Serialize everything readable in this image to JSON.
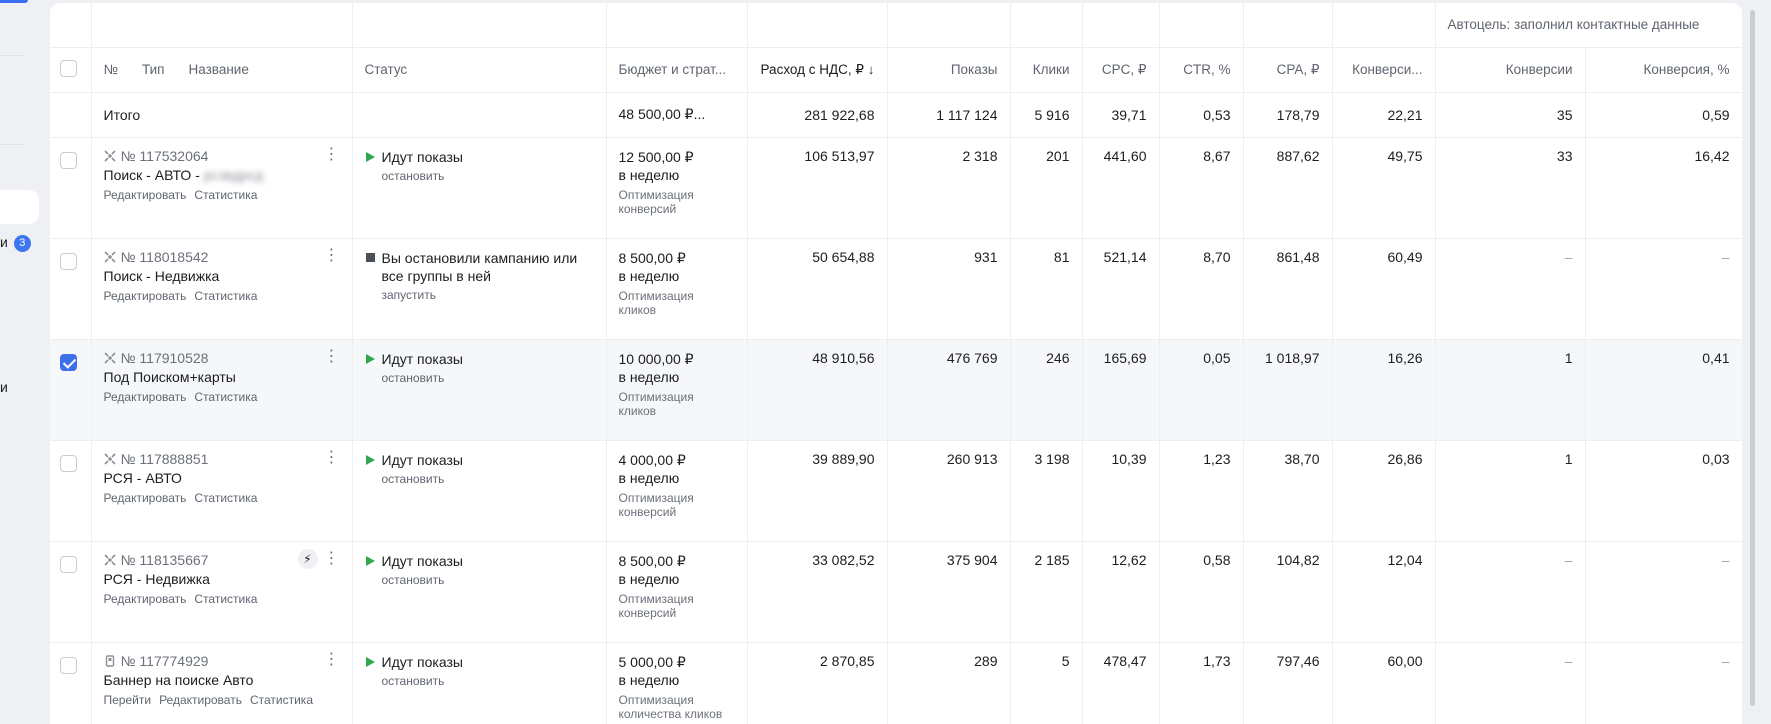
{
  "sidebar": {
    "item_fragment": "и",
    "badge": "3",
    "item_fragment2": "и"
  },
  "group_header": {
    "goal": "Автоцель: заполнил контактные данные"
  },
  "columns": {
    "no": "№",
    "type": "Тип",
    "name": "Название",
    "status": "Статус",
    "budget": "Бюджет и страт...",
    "spend": "Расход с НДС, ₽ ↓",
    "impressions": "Показы",
    "clicks": "Клики",
    "cpc": "CPC, ₽",
    "ctr": "CTR, %",
    "cpa": "CPA, ₽",
    "conv_total": "Конверси...",
    "conversions": "Конверсии",
    "conv_rate": "Конверсия, %"
  },
  "total": {
    "label": "Итого",
    "budget": "48 500,00 ₽...",
    "spend": "281 922,68",
    "impressions": "1 117 124",
    "clicks": "5 916",
    "cpc": "39,71",
    "ctr": "0,53",
    "cpa": "178,79",
    "conv_total": "22,21",
    "conversions": "35",
    "conv_rate": "0,59"
  },
  "links": {
    "edit": "Редактировать",
    "stats": "Статистика",
    "go": "Перейти"
  },
  "rows": [
    {
      "id": "№ 117532064",
      "name": "Поиск - АВТО - ",
      "name_blur": "рсзвдрсд",
      "status": "Идут показы",
      "status_action": "остановить",
      "budget": "12 500,00 ₽",
      "period": "в неделю",
      "strategy": "Оптимизация конверсий",
      "spend": "106 513,97",
      "impressions": "2 318",
      "clicks": "201",
      "cpc": "441,60",
      "ctr": "8,67",
      "cpa": "887,62",
      "conv_total": "49,75",
      "conversions": "33",
      "conv_rate": "16,42"
    },
    {
      "id": "№ 118018542",
      "name": "Поиск - Недвижка",
      "status": "Вы остановили кампанию или все группы в ней",
      "status_action": "запустить",
      "budget": "8 500,00 ₽",
      "period": "в неделю",
      "strategy": "Оптимизация кликов",
      "spend": "50 654,88",
      "impressions": "931",
      "clicks": "81",
      "cpc": "521,14",
      "ctr": "8,70",
      "cpa": "861,48",
      "conv_total": "60,49",
      "conversions": "–",
      "conv_rate": "–"
    },
    {
      "id": "№ 117910528",
      "name": "Под Поиском+карты",
      "status": "Идут показы",
      "status_action": "остановить",
      "budget": "10 000,00 ₽",
      "period": "в неделю",
      "strategy": "Оптимизация кликов",
      "spend": "48 910,56",
      "impressions": "476 769",
      "clicks": "246",
      "cpc": "165,69",
      "ctr": "0,05",
      "cpa": "1 018,97",
      "conv_total": "16,26",
      "conversions": "1",
      "conv_rate": "0,41"
    },
    {
      "id": "№ 117888851",
      "name": "РСЯ - АВТО",
      "status": "Идут показы",
      "status_action": "остановить",
      "budget": "4 000,00 ₽",
      "period": "в неделю",
      "strategy": "Оптимизация конверсий",
      "spend": "39 889,90",
      "impressions": "260 913",
      "clicks": "3 198",
      "cpc": "10,39",
      "ctr": "1,23",
      "cpa": "38,70",
      "conv_total": "26,86",
      "conversions": "1",
      "conv_rate": "0,03"
    },
    {
      "id": "№ 118135667",
      "name": "РСЯ - Недвижка",
      "status": "Идут показы",
      "status_action": "остановить",
      "budget": "8 500,00 ₽",
      "period": "в неделю",
      "strategy": "Оптимизация конверсий",
      "spend": "33 082,52",
      "impressions": "375 904",
      "clicks": "2 185",
      "cpc": "12,62",
      "ctr": "0,58",
      "cpa": "104,82",
      "conv_total": "12,04",
      "conversions": "–",
      "conv_rate": "–"
    },
    {
      "id": "№ 117774929",
      "name": "Баннер на поиске Авто",
      "status": "Идут показы",
      "status_action": "остановить",
      "budget": "5 000,00 ₽",
      "period": "в неделю",
      "strategy": "Оптимизация количества кликов",
      "spend": "2 870,85",
      "impressions": "289",
      "clicks": "5",
      "cpc": "478,47",
      "ctr": "1,73",
      "cpa": "797,46",
      "conv_total": "60,00",
      "conversions": "–",
      "conv_rate": "–"
    }
  ],
  "icons": {
    "type_text": "campaign-type-text-icon",
    "type_banner": "campaign-type-banner-icon",
    "bolt": "bolt-icon",
    "kebab": "kebab-menu-icon",
    "play": "play-icon",
    "stop": "stop-icon"
  },
  "colors": {
    "accent": "#3d6fe8",
    "running": "#2fa84f",
    "stopped": "#4c5058"
  }
}
